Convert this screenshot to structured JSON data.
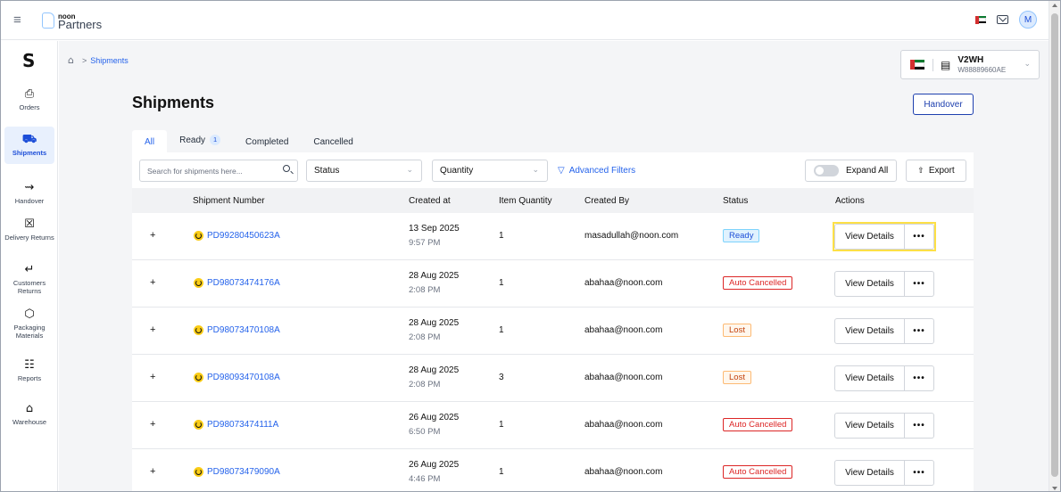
{
  "app": {
    "logo_small": "noon",
    "logo_name": "Partners",
    "user_initial": "M"
  },
  "sidebar": {
    "items": [
      {
        "label": "Orders",
        "icon": "orders-icon",
        "glyph": "⎙"
      },
      {
        "label": "Shipments",
        "icon": "truck-icon",
        "glyph": "⛟",
        "active": true
      },
      {
        "label": "Handover",
        "icon": "handshake-icon",
        "glyph": "⇝"
      },
      {
        "label": "Delivery Returns",
        "icon": "delivery-returns-icon",
        "glyph": "☒"
      },
      {
        "label": "Customers Returns",
        "icon": "customer-returns-icon",
        "glyph": "↵"
      },
      {
        "label": "Packaging Materials",
        "icon": "package-icon",
        "glyph": "⬡"
      },
      {
        "label": "Reports",
        "icon": "reports-icon",
        "glyph": "☷"
      },
      {
        "label": "Warehouse",
        "icon": "warehouse-icon",
        "glyph": "⌂"
      }
    ]
  },
  "breadcrumb": {
    "current": "Shipments"
  },
  "warehouse": {
    "name": "V2WH",
    "code": "W88889660AE"
  },
  "page": {
    "title": "Shipments",
    "handover_label": "Handover"
  },
  "tabs": [
    {
      "label": "All",
      "active": true
    },
    {
      "label": "Ready",
      "badge": "1"
    },
    {
      "label": "Completed"
    },
    {
      "label": "Cancelled"
    }
  ],
  "filters": {
    "search_placeholder": "Search for shipments here...",
    "status_label": "Status",
    "quantity_label": "Quantity",
    "advanced_label": "Advanced Filters",
    "expand_label": "Expand All",
    "export_label": "Export"
  },
  "table": {
    "headers": [
      "Shipment Number",
      "Created at",
      "Item Quantity",
      "Created By",
      "Status",
      "Actions"
    ],
    "view_details_label": "View Details",
    "more_label": "•••",
    "rows": [
      {
        "number": "PD99280450623A",
        "date": "13 Sep 2025",
        "time": "9:57 PM",
        "qty": "1",
        "by": "masadullah@noon.com",
        "status": "Ready",
        "status_type": "ready",
        "highlight": true
      },
      {
        "number": "PD98073474176A",
        "date": "28 Aug 2025",
        "time": "2:08 PM",
        "qty": "1",
        "by": "abahaa@noon.com",
        "status": "Auto Cancelled",
        "status_type": "autoc"
      },
      {
        "number": "PD98073470108A",
        "date": "28 Aug 2025",
        "time": "2:08 PM",
        "qty": "1",
        "by": "abahaa@noon.com",
        "status": "Lost",
        "status_type": "lost"
      },
      {
        "number": "PD98093470108A",
        "date": "28 Aug 2025",
        "time": "2:08 PM",
        "qty": "3",
        "by": "abahaa@noon.com",
        "status": "Lost",
        "status_type": "lost"
      },
      {
        "number": "PD98073474111A",
        "date": "26 Aug 2025",
        "time": "6:50 PM",
        "qty": "1",
        "by": "abahaa@noon.com",
        "status": "Auto Cancelled",
        "status_type": "autoc"
      },
      {
        "number": "PD98073479090A",
        "date": "26 Aug 2025",
        "time": "4:46 PM",
        "qty": "1",
        "by": "abahaa@noon.com",
        "status": "Auto Cancelled",
        "status_type": "autoc"
      }
    ]
  }
}
